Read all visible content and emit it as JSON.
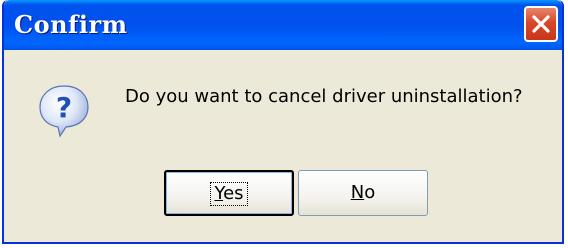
{
  "window": {
    "title": "Confirm"
  },
  "dialog": {
    "icon": "question-icon",
    "message": "Do you want to cancel driver uninstallation?"
  },
  "buttons": {
    "yes": {
      "accel": "Y",
      "rest": "es"
    },
    "no": {
      "accel": "N",
      "rest": "o"
    }
  },
  "colors": {
    "titlebar": "#0053ee",
    "dialog_bg": "#ece9d8",
    "close_button": "#d8472a",
    "icon_blue": "#1e4fb8"
  }
}
